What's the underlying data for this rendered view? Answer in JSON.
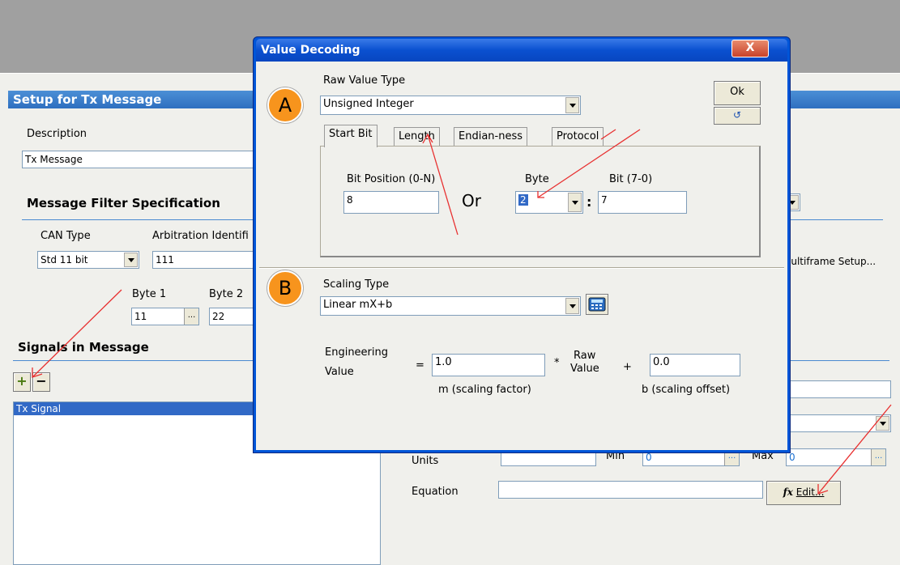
{
  "background_window": {
    "title": "Setup for Tx Message",
    "description_label": "Description",
    "description_value": "Tx Message",
    "filter_section": "Message Filter Specification",
    "can_type_label": "CAN Type",
    "can_type_value": "Std 11 bit",
    "arb_id_label": "Arbitration Identifi",
    "arb_id_value": "111",
    "byte1_label": "Byte 1",
    "byte1_value": "11",
    "byte2_label": "Byte 2",
    "byte2_value": "22",
    "signals_section": "Signals in Message",
    "add_button": "+",
    "remove_button": "−",
    "signals": [
      "Tx Signal"
    ],
    "multiframe_button": "Multiframe Setup...",
    "units_label": "Units",
    "min_label": "Min",
    "min_value": "0",
    "max_label": "Max",
    "max_value": "0",
    "equation_label": "Equation",
    "equation_value": "",
    "edit_button": "Edit...",
    "edit_icon": "fx"
  },
  "dialog": {
    "title": "Value Decoding",
    "close_label": "X",
    "ok_label": "Ok",
    "undo_icon": "undo-icon",
    "marker_a": "A",
    "marker_b": "B",
    "raw_value_type_label": "Raw Value Type",
    "raw_value_type_value": "Unsigned Integer",
    "tabs": [
      "Start Bit",
      "Length",
      "Endian-ness",
      "Protocol"
    ],
    "bit_position_label": "Bit Position (0-N)",
    "bit_position_value": "8",
    "or_label": "Or",
    "byte_label": "Byte",
    "byte_value": "2",
    "colon": ":",
    "bit_label": "Bit (7-0)",
    "bit_value": "7",
    "scaling_type_label": "Scaling Type",
    "scaling_type_value": "Linear mX+b",
    "eng_value_label_1": "Engineering",
    "eng_value_label_2": "Value",
    "equals": "=",
    "m_value": "1.0",
    "times": "*",
    "raw_label_1": "Raw",
    "raw_label_2": "Value",
    "plus": "+",
    "b_value": "0.0",
    "m_caption": "m (scaling factor)",
    "b_caption": "b (scaling offset)"
  },
  "colors": {
    "titlebar": "#0055d8",
    "bg_title": "#2e6fc0",
    "marker": "#f7941d",
    "annotation_arrow": "#e83030"
  }
}
